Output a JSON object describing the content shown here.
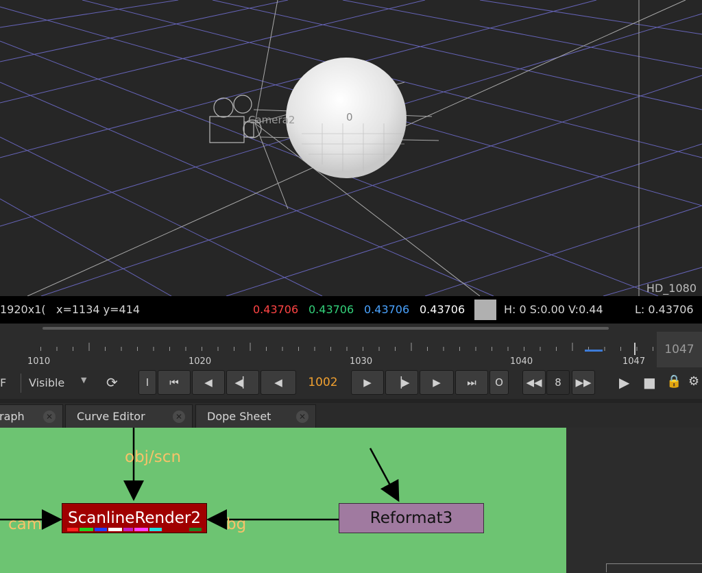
{
  "viewer": {
    "camera_label": "Camera2",
    "axis_label": "0",
    "format_label": "HD_1080"
  },
  "infobar": {
    "resolution": "1920x1(",
    "coords": "x=1134 y=414",
    "r": "0.43706",
    "g": "0.43706",
    "b": "0.43706",
    "a": "0.43706",
    "hsv": "H:  0 S:0.00 V:0.44",
    "lum": "L: 0.43706",
    "colors": {
      "r": "#ff4444",
      "g": "#33d17a",
      "b": "#4aa3ff"
    }
  },
  "timeline": {
    "ticks": [
      "1010",
      "1020",
      "1030",
      "1040",
      "1047"
    ],
    "end_frame": "1047"
  },
  "controls": {
    "view_mode": "Visible",
    "in_label": "I",
    "out_label": "O",
    "current_frame": "1002",
    "increment": "8"
  },
  "tabs": [
    {
      "label": "raph"
    },
    {
      "label": "Curve Editor"
    },
    {
      "label": "Dope Sheet"
    }
  ],
  "nodes": {
    "render": "ScanlineRender2",
    "reformat": "Reformat3",
    "pin_obj": "obj/scn",
    "pin_cam": "cam",
    "pin_bg": "bg"
  }
}
